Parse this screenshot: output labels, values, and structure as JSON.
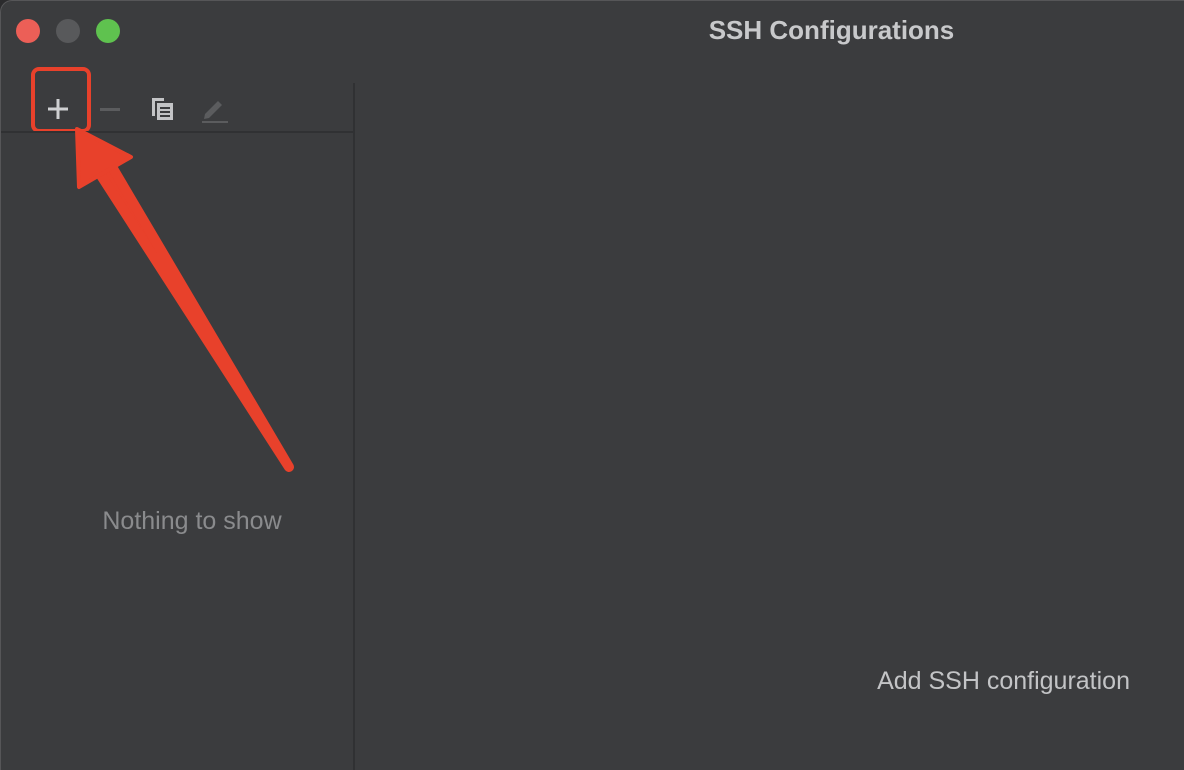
{
  "window": {
    "title": "SSH Configurations"
  },
  "toolbar": {
    "add_icon": "plus-icon",
    "remove_icon": "minus-icon",
    "copy_icon": "copy-icon",
    "edit_icon": "pencil-icon"
  },
  "list": {
    "empty_text": "Nothing to show"
  },
  "detail": {
    "add_link": "Add SSH configuration"
  },
  "colors": {
    "annotation": "#e8412b",
    "close": "#ec5f57",
    "maximize": "#5fc24f",
    "background": "#3b3c3e"
  }
}
